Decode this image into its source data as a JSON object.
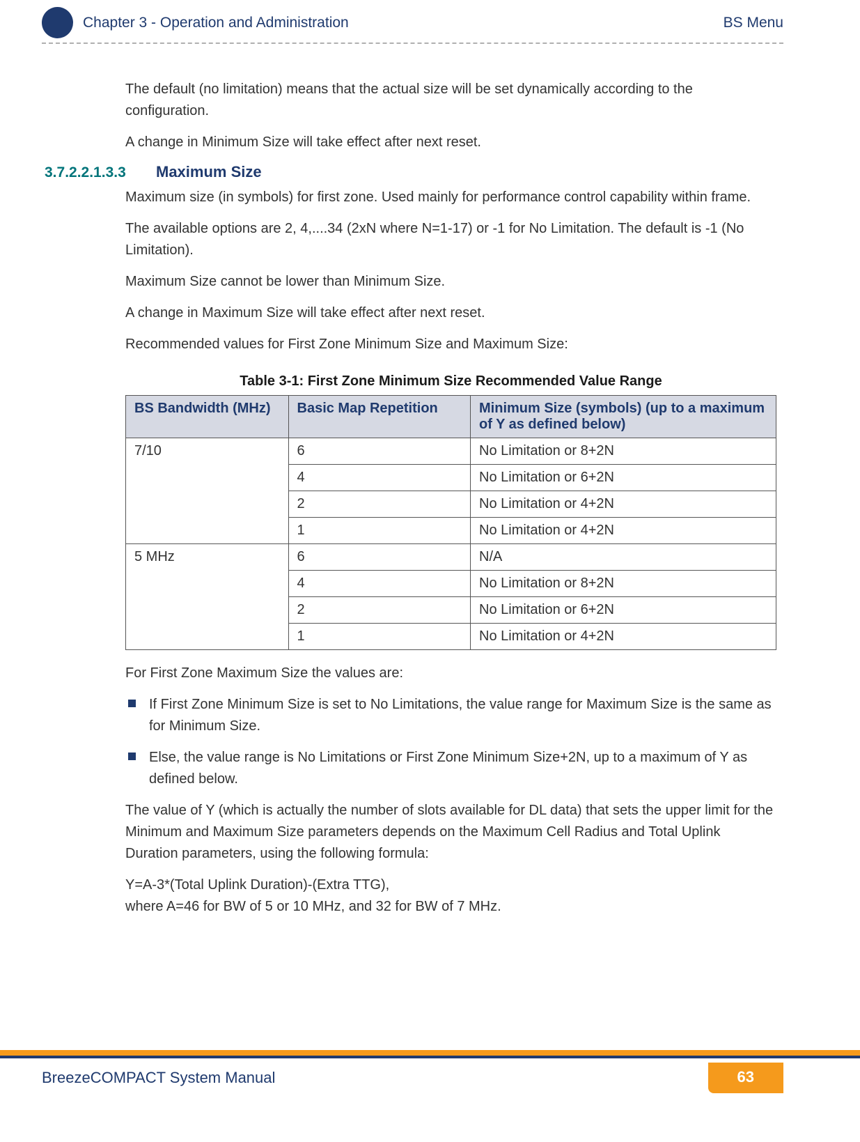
{
  "header": {
    "chapter": "Chapter 3 - Operation and Administration",
    "menu": "BS Menu"
  },
  "intro": {
    "p1": "The default (no limitation) means that the actual size will be set dynamically according to the configuration.",
    "p2": "A change in Minimum Size will take effect after next reset."
  },
  "section": {
    "number": "3.7.2.2.1.3.3",
    "title": "Maximum Size",
    "p1": "Maximum size (in symbols) for first zone. Used mainly for performance control capability within frame.",
    "p2": "The available options are 2, 4,....34 (2xN where N=1-17) or -1 for No Limitation. The default is -1 (No Limitation).",
    "p3": "Maximum Size cannot be lower than Minimum Size.",
    "p4": "A change in Maximum Size will take effect after next reset.",
    "p5": "Recommended values for First Zone Minimum Size and Maximum Size:"
  },
  "table": {
    "caption": "Table 3-1: First Zone Minimum Size Recommended Value Range",
    "headers": {
      "h1": "BS Bandwidth (MHz)",
      "h2": "Basic Map Repetition",
      "h3": "Minimum Size (symbols) (up to a maximum of Y as defined below)"
    },
    "groupA": {
      "bw": "7/10",
      "r1": {
        "rep": "6",
        "min": "No Limitation or 8+2N"
      },
      "r2": {
        "rep": "4",
        "min": "No Limitation or 6+2N"
      },
      "r3": {
        "rep": "2",
        "min": "No Limitation or 4+2N"
      },
      "r4": {
        "rep": "1",
        "min": "No Limitation or 4+2N"
      }
    },
    "groupB": {
      "bw": "5 MHz",
      "r1": {
        "rep": "6",
        "min": "N/A"
      },
      "r2": {
        "rep": "4",
        "min": "No Limitation or 8+2N"
      },
      "r3": {
        "rep": "2",
        "min": "No Limitation or 6+2N"
      },
      "r4": {
        "rep": "1",
        "min": "No Limitation or 4+2N"
      }
    }
  },
  "after": {
    "p1": "For First Zone Maximum Size the values are:",
    "b1": "If First Zone Minimum Size is set to No Limitations, the value range for Maximum Size is the same as for Minimum Size.",
    "b2": "Else, the value range is No Limitations or First Zone Minimum Size+2N, up to a maximum of Y as defined below.",
    "p2": "The value of Y (which is actually the number of slots available for DL data) that sets the upper limit for the Minimum and Maximum Size parameters depends on the Maximum Cell Radius and Total Uplink Duration parameters, using the following formula:",
    "p3a": "Y=A-3*(Total Uplink Duration)-(Extra TTG),",
    "p3b": "where A=46 for BW of 5 or 10 MHz, and 32 for BW of 7 MHz."
  },
  "footer": {
    "title": "BreezeCOMPACT System Manual",
    "page": "63"
  }
}
